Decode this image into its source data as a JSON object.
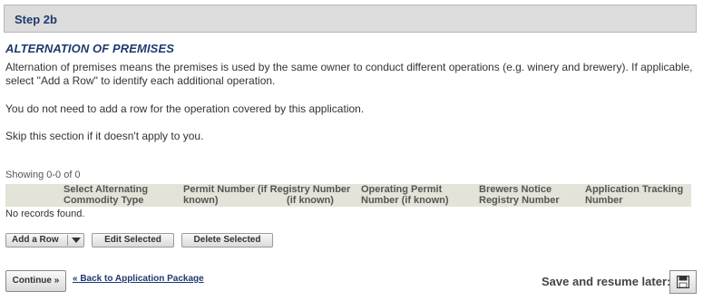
{
  "step": {
    "title": "Step 2b"
  },
  "section": {
    "title": "ALTERNATION OF PREMISES",
    "paragraph1": "Alternation of premises means the premises is used by the same owner to conduct different operations (e.g. winery and brewery). If applicable, select \"Add a Row\" to identify each additional operation.",
    "paragraph2": "You do not need to add a row for the operation covered by this application.",
    "paragraph3": "Skip this section if it doesn't apply to you."
  },
  "grid": {
    "showing": "Showing 0-0 of 0",
    "columns": [
      "Select Alternating Commodity Type",
      "Permit Number (if known)",
      "Registry Number (if known)",
      "Operating Permit Number (if known)",
      "Brewers Notice Registry Number",
      "Application Tracking Number"
    ],
    "empty_message": "No records found."
  },
  "toolbar": {
    "add_row_label": "Add a Row",
    "edit_selected_label": "Edit Selected",
    "delete_selected_label": "Delete Selected"
  },
  "footer": {
    "continue_label": "Continue »",
    "back_link_label": "« Back to Application Package",
    "save_label": "Save and resume later:",
    "save_icon": "floppy-disk-icon"
  }
}
